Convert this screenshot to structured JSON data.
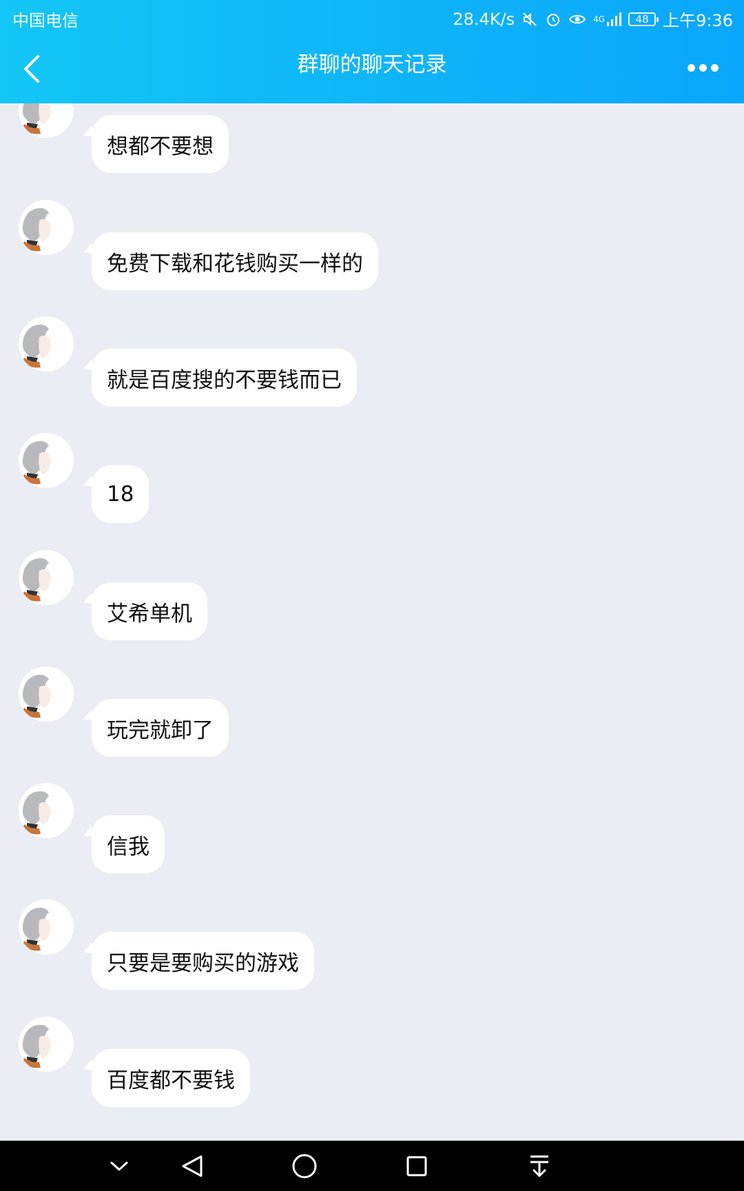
{
  "status_bar": {
    "carrier": "中国电信",
    "network_speed": "28.4K/s",
    "signal_label": "4G",
    "battery": "48",
    "time": "上午9:36"
  },
  "header": {
    "title": "群聊的聊天记录"
  },
  "messages": [
    {
      "text": "想都不要想"
    },
    {
      "text": "免费下载和花钱购买一样的"
    },
    {
      "text": "就是百度搜的不要钱而已"
    },
    {
      "text": "18"
    },
    {
      "text": "艾希单机"
    },
    {
      "text": "玩完就卸了"
    },
    {
      "text": "信我"
    },
    {
      "text": "只要是要购买的游戏"
    },
    {
      "text": "百度都不要钱"
    }
  ],
  "theme": {
    "header_start": "#12c6f6",
    "header_end": "#0aa6fb",
    "chat_background": "#eaedf4",
    "bubble": "#ffffff"
  }
}
